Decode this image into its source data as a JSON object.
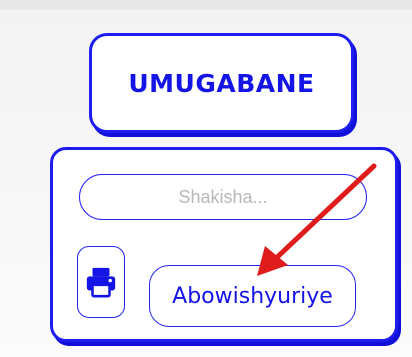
{
  "header": {
    "title": "UMUGABANE"
  },
  "panel": {
    "search": {
      "placeholder": "Shakisha...",
      "value": ""
    },
    "print": {
      "icon": "print-icon"
    },
    "subscribe": {
      "label": "Abowishyuriye"
    }
  },
  "annotation": {
    "arrow_color": "#e01b1b"
  },
  "colors": {
    "accent": "#1d1df0"
  }
}
